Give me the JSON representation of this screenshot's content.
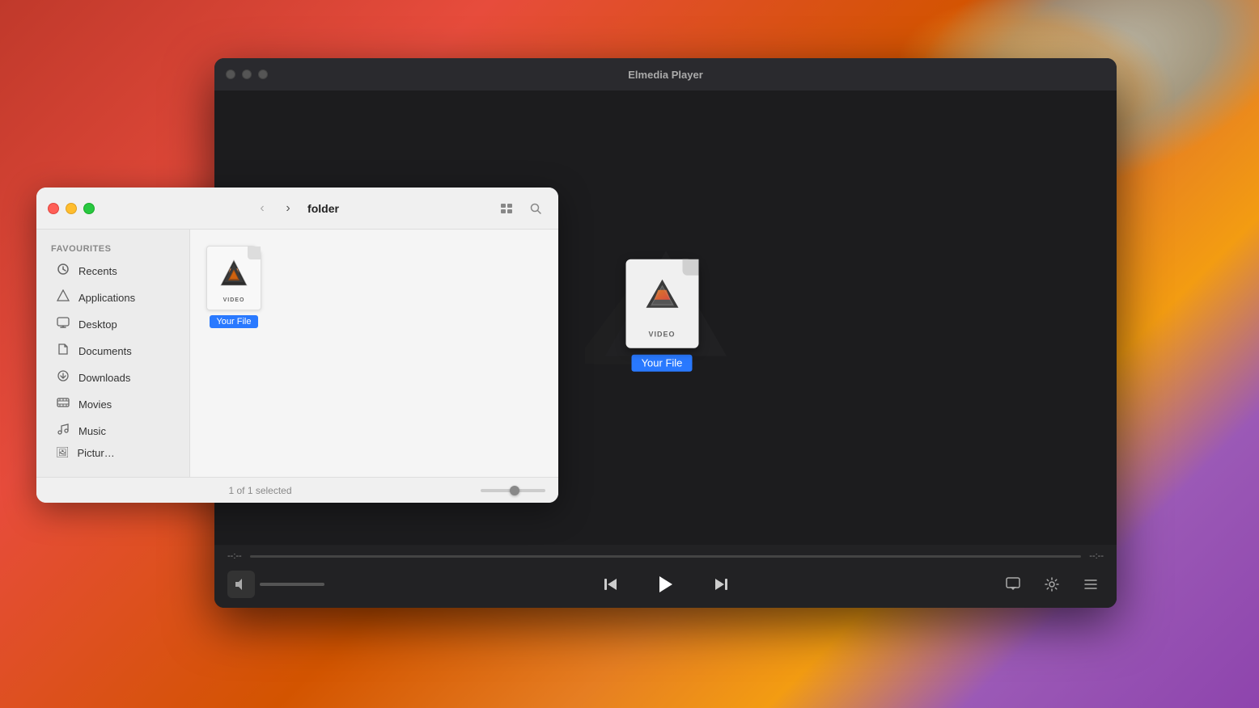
{
  "desktop": {
    "bg": "macOS Big Sur style gradient"
  },
  "player_window": {
    "title": "Elmedia Player",
    "controls": {
      "close_label": "●",
      "min_label": "●",
      "max_label": "●"
    },
    "time_left": "--:--",
    "time_right": "--:--",
    "file_name": "Your File",
    "transport": {
      "prev_label": "⏮",
      "play_label": "▶",
      "next_label": "⏭"
    },
    "right_controls": {
      "airplay_label": "airplay",
      "settings_label": "gear",
      "playlist_label": "list"
    }
  },
  "finder_window": {
    "folder_name": "folder",
    "sidebar": {
      "section_label": "Favourites",
      "items": [
        {
          "id": "recents",
          "icon": "🕐",
          "label": "Recents"
        },
        {
          "id": "applications",
          "icon": "🚀",
          "label": "Applications"
        },
        {
          "id": "desktop",
          "icon": "🖥",
          "label": "Desktop"
        },
        {
          "id": "documents",
          "icon": "📄",
          "label": "Documents"
        },
        {
          "id": "downloads",
          "icon": "⬇",
          "label": "Downloads"
        },
        {
          "id": "movies",
          "icon": "🎬",
          "label": "Movies"
        },
        {
          "id": "music",
          "icon": "♪",
          "label": "Music"
        },
        {
          "id": "pictures",
          "icon": "🖼",
          "label": "Pictur…"
        }
      ]
    },
    "file": {
      "name": "Your File",
      "type_label": "VIDEO"
    },
    "status": {
      "text": "1 of 1 selected"
    }
  }
}
